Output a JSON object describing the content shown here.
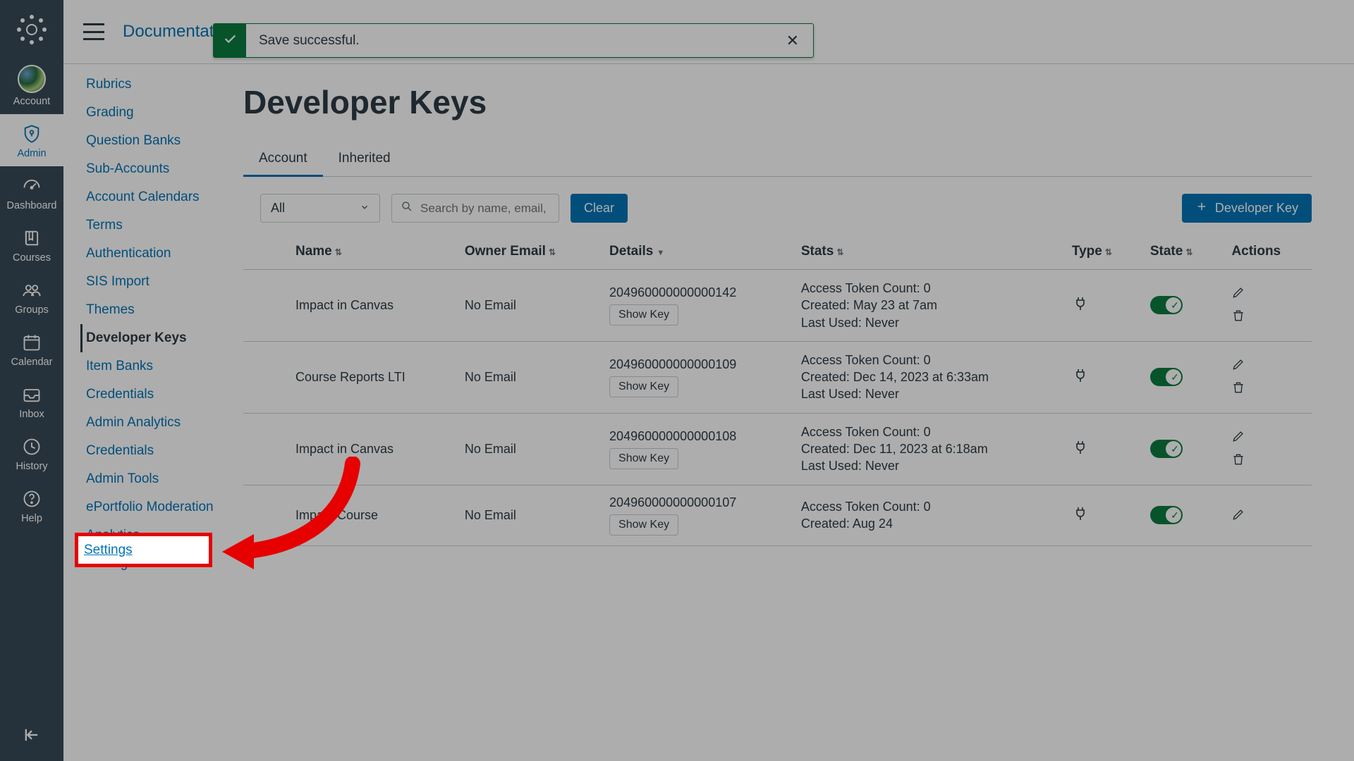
{
  "global_nav": {
    "account": "Account",
    "admin": "Admin",
    "dashboard": "Dashboard",
    "courses": "Courses",
    "groups": "Groups",
    "calendar": "Calendar",
    "inbox": "Inbox",
    "history": "History",
    "help": "Help"
  },
  "breadcrumb": "Documentation",
  "context_nav": [
    "Rubrics",
    "Grading",
    "Question Banks",
    "Sub-Accounts",
    "Account Calendars",
    "Terms",
    "Authentication",
    "SIS Import",
    "Themes",
    "Developer Keys",
    "Item Banks",
    "Credentials",
    "Admin Analytics",
    "Credentials",
    "Admin Tools",
    "ePortfolio Moderation",
    "Analytics",
    "Settings"
  ],
  "context_nav_current_index": 9,
  "flash": {
    "message": "Save successful."
  },
  "page_title": "Developer Keys",
  "tabs": {
    "account": "Account",
    "inherited": "Inherited"
  },
  "toolbar": {
    "filter_value": "All",
    "search_placeholder": "Search by name, email,",
    "clear": "Clear",
    "add_key": "Developer Key"
  },
  "columns": {
    "name": "Name",
    "owner_email": "Owner Email",
    "details": "Details",
    "stats": "Stats",
    "type": "Type",
    "state": "State",
    "actions": "Actions"
  },
  "show_key_label": "Show Key",
  "rows": [
    {
      "name": "Impact in Canvas",
      "owner_email": "No Email",
      "id": "204960000000000142",
      "stats_count": "Access Token Count: 0",
      "stats_created": "Created: May 23 at 7am",
      "stats_last": "Last Used: Never"
    },
    {
      "name": "Course Reports LTI",
      "owner_email": "No Email",
      "id": "204960000000000109",
      "stats_count": "Access Token Count: 0",
      "stats_created": "Created: Dec 14, 2023 at 6:33am",
      "stats_last": "Last Used: Never"
    },
    {
      "name": "Impact in Canvas",
      "owner_email": "No Email",
      "id": "204960000000000108",
      "stats_count": "Access Token Count: 0",
      "stats_created": "Created: Dec 11, 2023 at 6:18am",
      "stats_last": "Last Used: Never"
    },
    {
      "name": "Impact Course",
      "owner_email": "No Email",
      "id": "204960000000000107",
      "stats_count": "Access Token Count: 0",
      "stats_created": "Created: Aug 24",
      "stats_last": ""
    }
  ],
  "highlight_label": "Settings"
}
